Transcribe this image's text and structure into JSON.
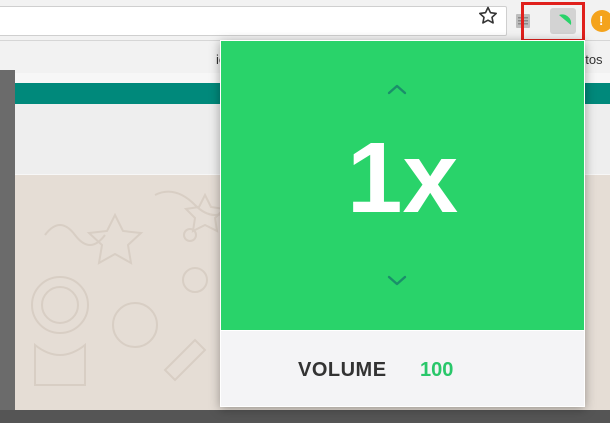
{
  "bookmarks": {
    "left_fragment": "ie",
    "right_fragment": "ritos"
  },
  "popup": {
    "speed": "1x",
    "volume_label": "VOLUME",
    "volume_value": "100"
  },
  "toolbar": {
    "extension_badge": "!"
  },
  "colors": {
    "accent_green": "#29d36a",
    "teal": "#00897b",
    "highlight_red": "#e0201c",
    "orange_extension": "#f4a31c"
  },
  "icons": [
    "star-icon",
    "document-extension-icon",
    "speed-extension-icon",
    "orange-extension-icon",
    "chevron-up-icon",
    "chevron-down-icon"
  ]
}
